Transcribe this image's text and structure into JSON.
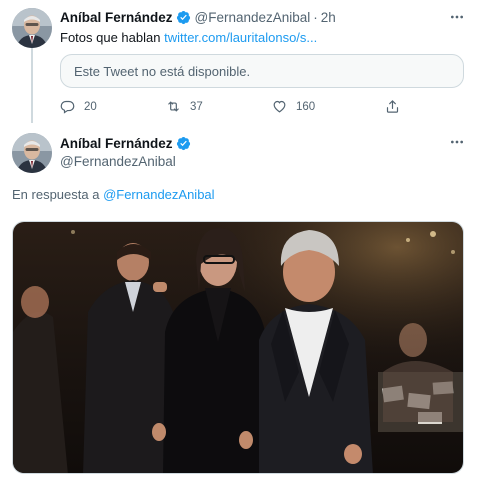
{
  "tweet1": {
    "author_name": "Aníbal Fernández",
    "handle": "@FernandezAnibal",
    "separator": "·",
    "time": "2h",
    "text_prefix": "Fotos que hablan ",
    "link_text": "twitter.com/lauritalonso/s...",
    "quoted_unavailable": "Este Tweet no está disponible.",
    "actions": {
      "replies": "20",
      "retweets": "37",
      "likes": "160"
    },
    "more_icon": "more-icon"
  },
  "tweet2": {
    "author_name": "Aníbal Fernández",
    "handle": "@FernandezAnibal",
    "reply_prefix": "En respuesta a ",
    "reply_handle": "@FernandezAnibal",
    "more_icon": "more-icon"
  },
  "colors": {
    "accent": "#1d9bf0",
    "text": "#0f1419",
    "secondary": "#536471",
    "border": "#cfd9de",
    "verified": "#1d9bf0"
  }
}
